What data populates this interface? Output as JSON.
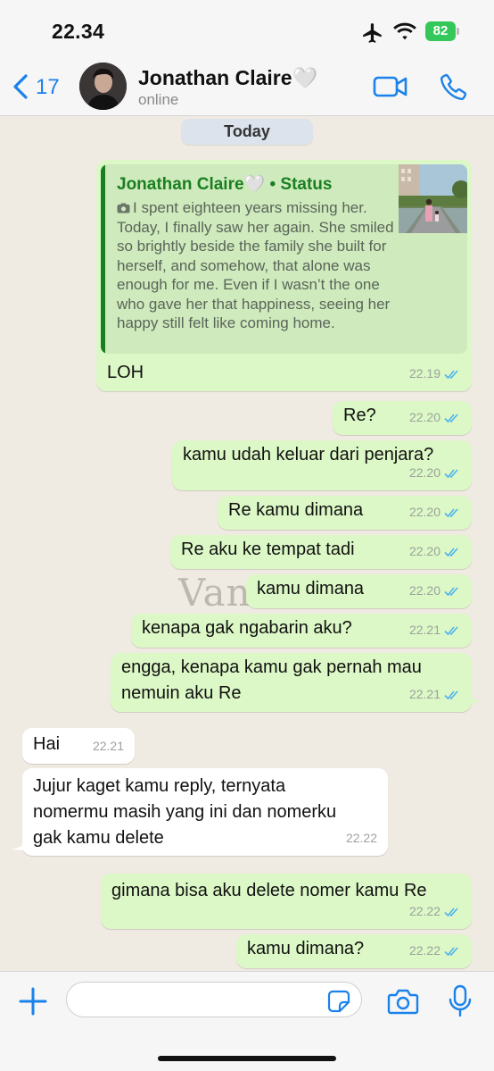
{
  "status_bar": {
    "time": "22.34",
    "battery": "82"
  },
  "header": {
    "back_count": "17",
    "contact_name": "Jonathan Claire🤍",
    "contact_status": "online"
  },
  "chat": {
    "date_label": "Today",
    "reply": {
      "title": "Jonathan Claire🤍 • Status",
      "text": "I spent eighteen years missing her. Today, I finally saw her again. She smiled so brightly beside the family she built for herself, and somehow, that alone was enough for me. Even if I wasn’t the one who gave her that happiness, seeing her happy still felt like coming home."
    },
    "messages": [
      {
        "text": "LOH",
        "time": "22.19"
      },
      {
        "text": "Re?",
        "time": "22.20"
      },
      {
        "text": "kamu udah keluar dari penjara?",
        "time": "22.20"
      },
      {
        "text": "Re kamu dimana",
        "time": "22.20"
      },
      {
        "text": "Re aku ke tempat tadi",
        "time": "22.20"
      },
      {
        "text": "kamu dimana",
        "time": "22.20"
      },
      {
        "text": "kenapa gak ngabarin aku?",
        "time": "22.21"
      },
      {
        "text": "engga, kenapa kamu gak pernah mau\nnemuin aku Re",
        "time": "22.21"
      },
      {
        "text": "Hai",
        "time": "22.21"
      },
      {
        "text": "Jujur kaget kamu reply, ternyata\nnomermu masih yang ini dan nomerku\ngak kamu delete",
        "time": "22.22"
      },
      {
        "text": "gimana bisa aku delete nomer kamu Re",
        "time": "22.22"
      },
      {
        "text": "kamu dimana?",
        "time": "22.22"
      }
    ],
    "watermark": "Vanilla"
  },
  "input": {
    "placeholder": ""
  },
  "colors": {
    "accent": "#1a82ea",
    "outgoing_bubble": "#dcf8c6",
    "incoming_bubble": "#ffffff",
    "reply_title": "#1a7f22",
    "read_ticks": "#4fb3ef",
    "background": "#efeae2"
  }
}
